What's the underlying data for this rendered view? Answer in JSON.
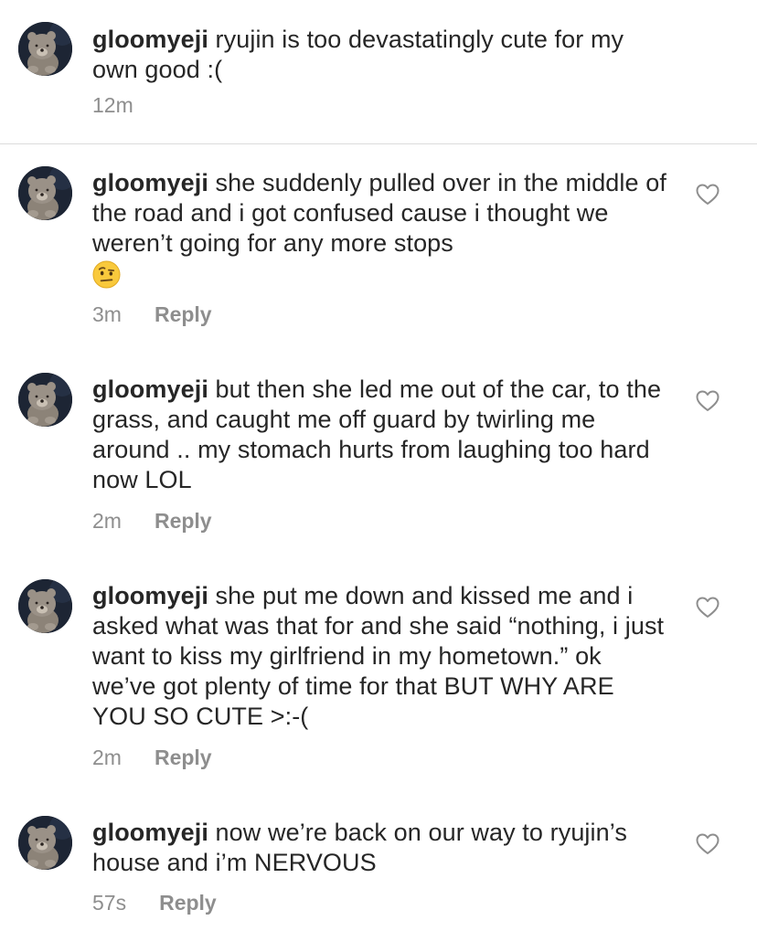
{
  "caption": {
    "username": "gloomyeji",
    "text": "ryujin is too devastatingly cute for my own good :(",
    "time": "12m"
  },
  "comments": [
    {
      "username": "gloomyeji",
      "text": "she suddenly pulled over in the middle of the road and i got confused cause i thought we weren’t going for any more stops",
      "emoji": "face-with-raised-eyebrow",
      "time": "3m",
      "reply_label": "Reply"
    },
    {
      "username": "gloomyeji",
      "text": "but then she led me out of the car, to the grass, and caught me off guard by twirling me around .. my stomach hurts from laughing too hard now LOL",
      "time": "2m",
      "reply_label": "Reply"
    },
    {
      "username": "gloomyeji",
      "text": "she put me down and kissed me and i asked what was that for and she said “nothing, i just want to kiss my girlfriend in my hometown.” ok we’ve got plenty of time for that BUT WHY ARE YOU SO CUTE >:-(",
      "time": "2m",
      "reply_label": "Reply"
    },
    {
      "username": "gloomyeji",
      "text": "now we’re back on our way to ryujin’s house and i’m NERVOUS",
      "time": "57s",
      "reply_label": "Reply"
    }
  ],
  "icons": {
    "avatar": "bear-avatar-icon",
    "like": "heart-outline-icon"
  },
  "colors": {
    "text": "#262626",
    "secondary": "#8e8e8e",
    "divider": "#dbdbdb"
  }
}
